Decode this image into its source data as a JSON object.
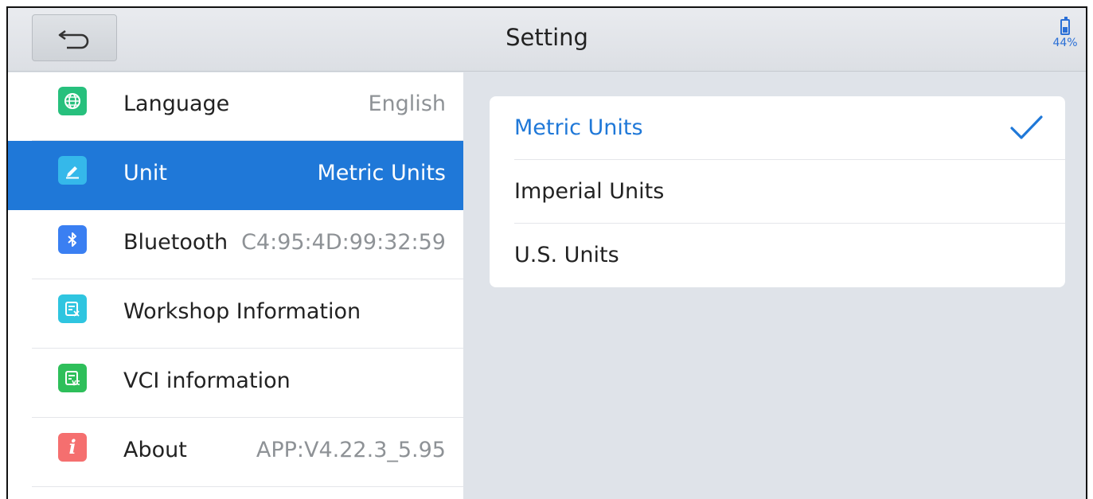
{
  "header": {
    "title": "Setting",
    "battery_label": "44%",
    "battery_level": 0.44
  },
  "sidebar": {
    "items": [
      {
        "label": "Language",
        "value": "English",
        "icon": "globe-icon",
        "color": "#27c07d"
      },
      {
        "label": "Unit",
        "value": "Metric Units",
        "icon": "ruler-pencil-icon",
        "color": "#35b8ea",
        "selected": true
      },
      {
        "label": "Bluetooth",
        "value": "C4:95:4D:99:32:59",
        "icon": "bluetooth-icon",
        "color": "#3a7ff2"
      },
      {
        "label": "Workshop Information",
        "value": "",
        "icon": "workshop-doc-icon",
        "color": "#2fc5e0"
      },
      {
        "label": "VCI information",
        "value": "",
        "icon": "vci-doc-icon",
        "color": "#2ebf5a"
      },
      {
        "label": "About",
        "value": "APP:V4.22.3_5.95",
        "icon": "info-icon",
        "color": "#f56f6f"
      }
    ]
  },
  "unit_options": [
    {
      "label": "Metric Units",
      "selected": true
    },
    {
      "label": "Imperial Units",
      "selected": false
    },
    {
      "label": "U.S. Units",
      "selected": false
    }
  ],
  "colors": {
    "accent": "#1f78d8",
    "background": "#dfe3e9"
  }
}
